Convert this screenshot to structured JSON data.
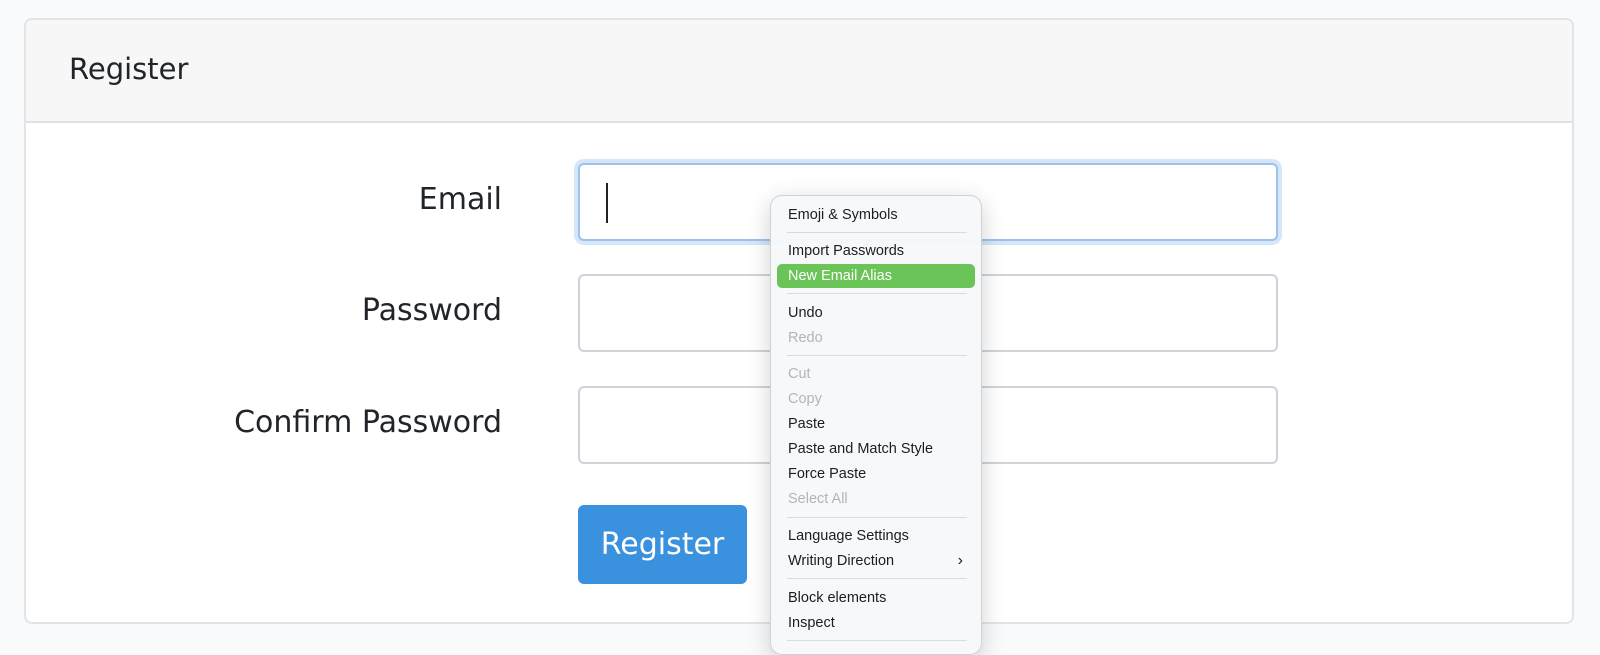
{
  "card": {
    "title": "Register"
  },
  "form": {
    "email_label": "Email",
    "email_value": "",
    "password_label": "Password",
    "password_value": "",
    "confirm_label": "Confirm Password",
    "confirm_value": "",
    "submit_label": "Register"
  },
  "context_menu": {
    "items": [
      {
        "label": "Emoji & Symbols",
        "enabled": true
      },
      {
        "label": "Import Passwords",
        "enabled": true
      },
      {
        "label": "New Email Alias",
        "enabled": true,
        "highlighted": true
      },
      {
        "label": "Undo",
        "enabled": true
      },
      {
        "label": "Redo",
        "enabled": false
      },
      {
        "label": "Cut",
        "enabled": false
      },
      {
        "label": "Copy",
        "enabled": false
      },
      {
        "label": "Paste",
        "enabled": true
      },
      {
        "label": "Paste and Match Style",
        "enabled": true
      },
      {
        "label": "Force Paste",
        "enabled": true
      },
      {
        "label": "Select All",
        "enabled": false
      },
      {
        "label": "Language Settings",
        "enabled": true
      },
      {
        "label": "Writing Direction",
        "enabled": true,
        "submenu": true
      },
      {
        "label": "Block elements",
        "enabled": true
      },
      {
        "label": "Inspect",
        "enabled": true
      }
    ],
    "submenu_icon": "chevron-right-icon"
  },
  "colors": {
    "primary": "#3a92de",
    "highlight": "#6bc457",
    "focus_ring": "#9cc3ec"
  }
}
